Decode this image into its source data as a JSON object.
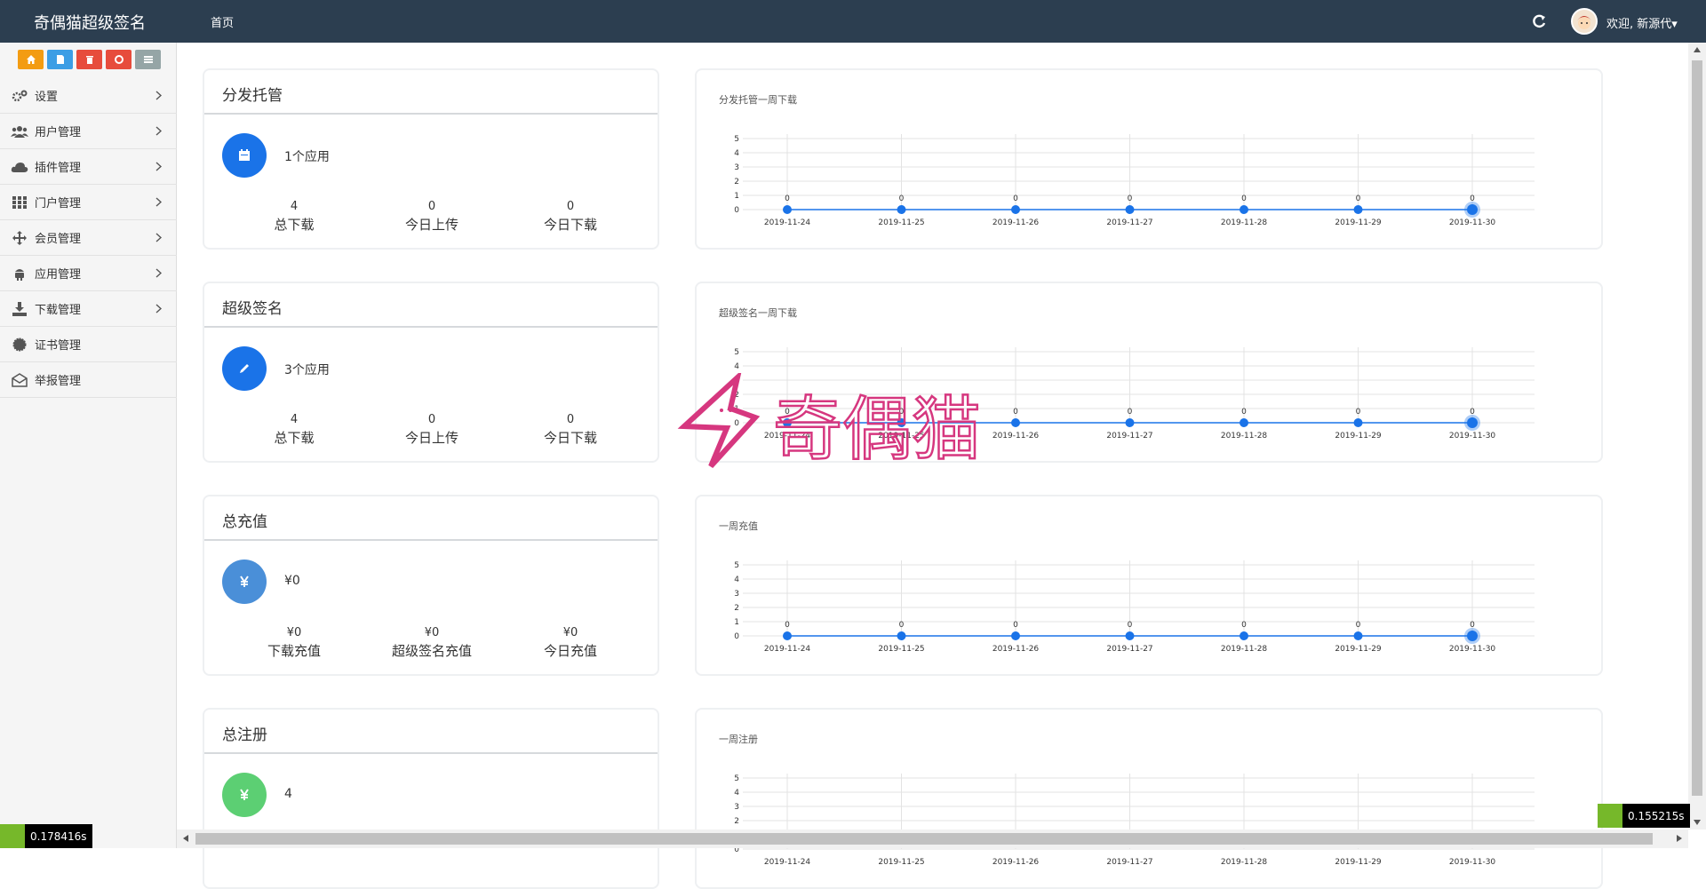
{
  "header": {
    "brand": "奇偶猫超级签名",
    "nav_home": "首页",
    "welcome": "欢迎, 新源代▾"
  },
  "sidebar": {
    "quick_buttons": [
      {
        "icon": "home-icon",
        "color": "#f39c12"
      },
      {
        "icon": "file-icon",
        "color": "#3c9ee5"
      },
      {
        "icon": "trash-icon",
        "color": "#e74c3c"
      },
      {
        "icon": "recycle-icon",
        "color": "#e74c3c"
      },
      {
        "icon": "list-icon",
        "color": "#95a5a6"
      }
    ],
    "items": [
      {
        "label": "设置",
        "icon": "gears-icon",
        "has_arrow": true
      },
      {
        "label": "用户管理",
        "icon": "users-icon",
        "has_arrow": true
      },
      {
        "label": "插件管理",
        "icon": "cloud-icon",
        "has_arrow": true
      },
      {
        "label": "门户管理",
        "icon": "grid-icon",
        "has_arrow": true
      },
      {
        "label": "会员管理",
        "icon": "arrows-icon",
        "has_arrow": true
      },
      {
        "label": "应用管理",
        "icon": "android-icon",
        "has_arrow": true
      },
      {
        "label": "下载管理",
        "icon": "download-icon",
        "has_arrow": true
      },
      {
        "label": "证书管理",
        "icon": "certificate-icon",
        "has_arrow": false
      },
      {
        "label": "举报管理",
        "icon": "envelope-open-icon",
        "has_arrow": false
      }
    ]
  },
  "panels": [
    {
      "title": "分发托管",
      "icon": "calendar-icon",
      "icon_color": "#1a73e8",
      "count": "1个应用",
      "stats": [
        {
          "value": "4",
          "label": "总下载"
        },
        {
          "value": "0",
          "label": "今日上传"
        },
        {
          "value": "0",
          "label": "今日下载"
        }
      ],
      "chart_title": "分发托管一周下载"
    },
    {
      "title": "超级签名",
      "icon": "pencil-icon",
      "icon_color": "#1a73e8",
      "count": "3个应用",
      "stats": [
        {
          "value": "4",
          "label": "总下载"
        },
        {
          "value": "0",
          "label": "今日上传"
        },
        {
          "value": "0",
          "label": "今日下载"
        }
      ],
      "chart_title": "超级签名一周下载"
    },
    {
      "title": "总充值",
      "icon": "yen-icon",
      "icon_color": "#4a8fd8",
      "count": "¥0",
      "stats": [
        {
          "value": "¥0",
          "label": "下载充值"
        },
        {
          "value": "¥0",
          "label": "超级签名充值"
        },
        {
          "value": "¥0",
          "label": "今日充值"
        }
      ],
      "chart_title": "一周充值"
    },
    {
      "title": "总注册",
      "icon": "yen-icon",
      "icon_color": "#5ccf73",
      "count": "4",
      "stats": [],
      "chart_title": "一周注册"
    }
  ],
  "chart_data": [
    {
      "type": "line",
      "title": "分发托管一周下载",
      "x": [
        "2019-11-24",
        "2019-11-25",
        "2019-11-26",
        "2019-11-27",
        "2019-11-28",
        "2019-11-29",
        "2019-11-30"
      ],
      "values": [
        0,
        0,
        0,
        0,
        0,
        0,
        0
      ],
      "ylim": [
        0,
        5
      ],
      "yticks": [
        0,
        1,
        2,
        3,
        4,
        5
      ],
      "grid": true,
      "color": "#1a73e8"
    },
    {
      "type": "line",
      "title": "超级签名一周下载",
      "x": [
        "2019-11-24",
        "2019-11-25",
        "2019-11-26",
        "2019-11-27",
        "2019-11-28",
        "2019-11-29",
        "2019-11-30"
      ],
      "values": [
        0,
        0,
        0,
        0,
        0,
        0,
        0
      ],
      "ylim": [
        0,
        5
      ],
      "yticks": [
        0,
        1,
        2,
        3,
        4,
        5
      ],
      "grid": true,
      "color": "#1a73e8"
    },
    {
      "type": "line",
      "title": "一周充值",
      "x": [
        "2019-11-24",
        "2019-11-25",
        "2019-11-26",
        "2019-11-27",
        "2019-11-28",
        "2019-11-29",
        "2019-11-30"
      ],
      "values": [
        0,
        0,
        0,
        0,
        0,
        0,
        0
      ],
      "ylim": [
        0,
        5
      ],
      "yticks": [
        0,
        1,
        2,
        3,
        4,
        5
      ],
      "grid": true,
      "color": "#1a73e8"
    },
    {
      "type": "line",
      "title": "一周注册",
      "x": [
        "2019-11-24",
        "2019-11-25",
        "2019-11-26",
        "2019-11-27",
        "2019-11-28",
        "2019-11-29",
        "2019-11-30"
      ],
      "values": [],
      "ylim": [
        0,
        5
      ],
      "yticks": [
        0,
        1,
        2,
        3,
        4,
        5
      ],
      "grid": true,
      "color": "#1a73e8"
    }
  ],
  "timers": {
    "left": "0.178416s",
    "right": "0.155215s"
  },
  "watermark": {
    "text": "奇偶猫",
    "color": "#d6377f"
  }
}
